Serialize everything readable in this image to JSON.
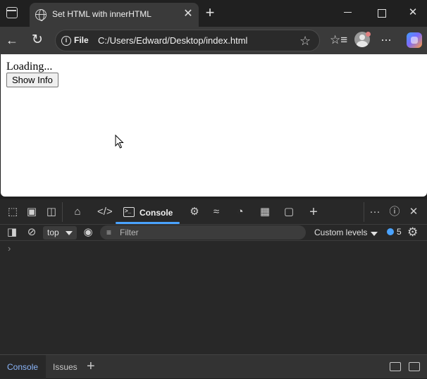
{
  "browser": {
    "tab_title": "Set HTML with innerHTML",
    "tab_close": "✕",
    "new_tab": "+",
    "file_chip": "File",
    "url": "C:/Users/Edward/Desktop/index.html",
    "win_close": "✕"
  },
  "page": {
    "text": "Loading...",
    "button_label": "Show Info"
  },
  "devtools": {
    "console_tab": "Console",
    "context": "top",
    "filter_placeholder": "Filter",
    "levels": "Custom levels",
    "issues_count": "5",
    "prompt": "›",
    "drawer_tabs": [
      "Console",
      "Issues"
    ],
    "drawer_add": "+",
    "colors": {
      "accent": "#4aa3ff",
      "active_drawer_tab": "#8ab4f8"
    }
  }
}
